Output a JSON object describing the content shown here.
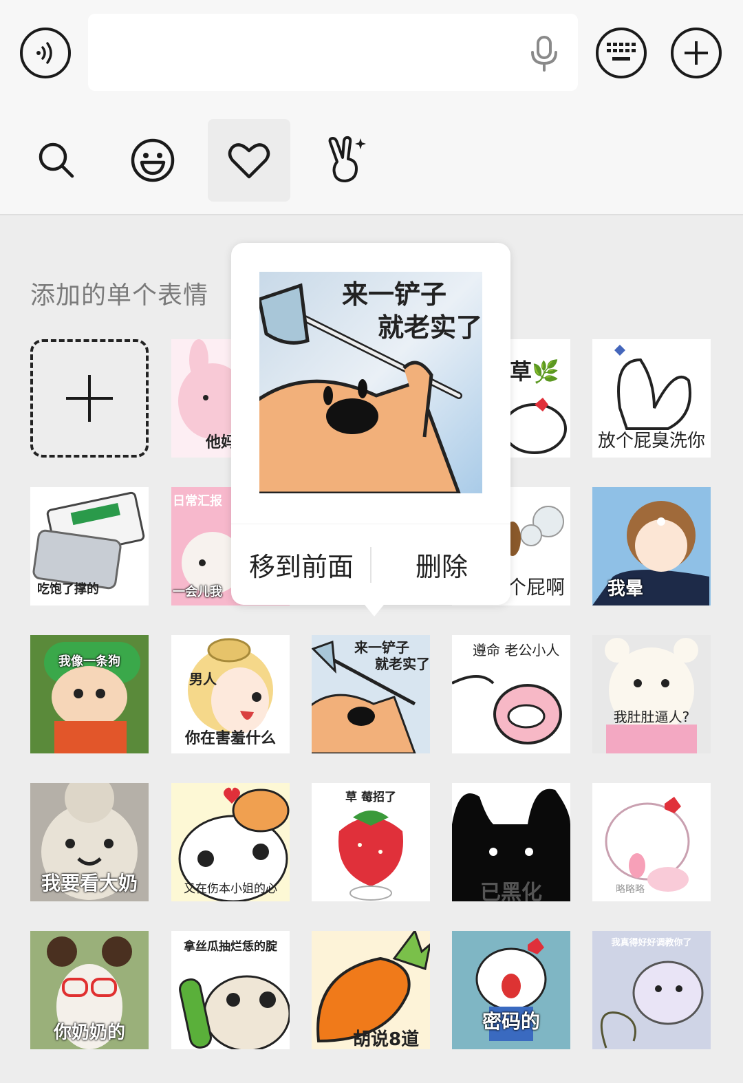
{
  "toolbar": {
    "voice_icon": "voice-wave-icon",
    "input_placeholder": "",
    "mic_icon": "microphone-icon",
    "keyboard_icon": "keyboard-icon",
    "plus_icon": "plus-icon"
  },
  "tabs": [
    {
      "icon": "search-icon"
    },
    {
      "icon": "smiley-icon"
    },
    {
      "icon": "heart-icon"
    },
    {
      "icon": "sparkle-hand-icon"
    }
  ],
  "section_title": "添加的单个表情",
  "popup": {
    "image_caption_line1": "来一铲子",
    "image_caption_line2": "就老实了",
    "move_front": "移到前面",
    "delete": "删除"
  },
  "stickers": {
    "r1c2": "他妈",
    "r1c4": "草🌿",
    "r1c5": "放个屁臭洗你",
    "r2c1": "吃饱了撑的",
    "r2c2_top": "日常汇报",
    "r2c2_bottom": "一会儿我",
    "r2c4": "个屁啊",
    "r2c5": "我晕",
    "r3c1": "我像一条狗",
    "r3c2_top": "男人",
    "r3c2_bottom": "你在害羞什么",
    "r3c3_top": "来一铲子",
    "r3c3_top2": "就老实了",
    "r3c4": "遵命 老公小人",
    "r3c5": "我肚肚逼人?",
    "r4c1": "我要看大奶",
    "r4c2": "又在伤本小姐的心",
    "r4c3": "草 莓招了",
    "r4c4": "已黑化",
    "r4c5": "略略略",
    "r5c1": "你奶奶的",
    "r5c2": "拿丝瓜抽烂恁的腚",
    "r5c3": "胡说8道",
    "r5c4": "密码的",
    "r5c5": "我真得好好调教你了"
  }
}
